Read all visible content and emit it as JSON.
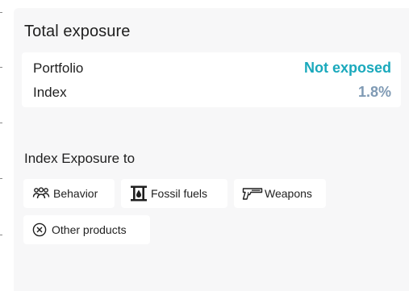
{
  "card": {
    "title": "Total exposure",
    "rows": [
      {
        "label": "Portfolio",
        "value": "Not exposed",
        "color": "#1aa9bc"
      },
      {
        "label": "Index",
        "value": "1.8%",
        "color": "#7f9ab4"
      }
    ]
  },
  "index_exposure": {
    "title": "Index Exposure to",
    "chips": [
      {
        "label": "Behavior",
        "icon": "people-group-icon"
      },
      {
        "label": "Fossil fuels",
        "icon": "oil-barrel-icon"
      },
      {
        "label": "Weapons",
        "icon": "gun-icon"
      },
      {
        "label": "Other products",
        "icon": "circle-x-icon"
      }
    ]
  },
  "colors": {
    "card_background": "#f7f7f8",
    "accent_teal": "#1aa9bc",
    "accent_slate": "#7f9ab4"
  }
}
